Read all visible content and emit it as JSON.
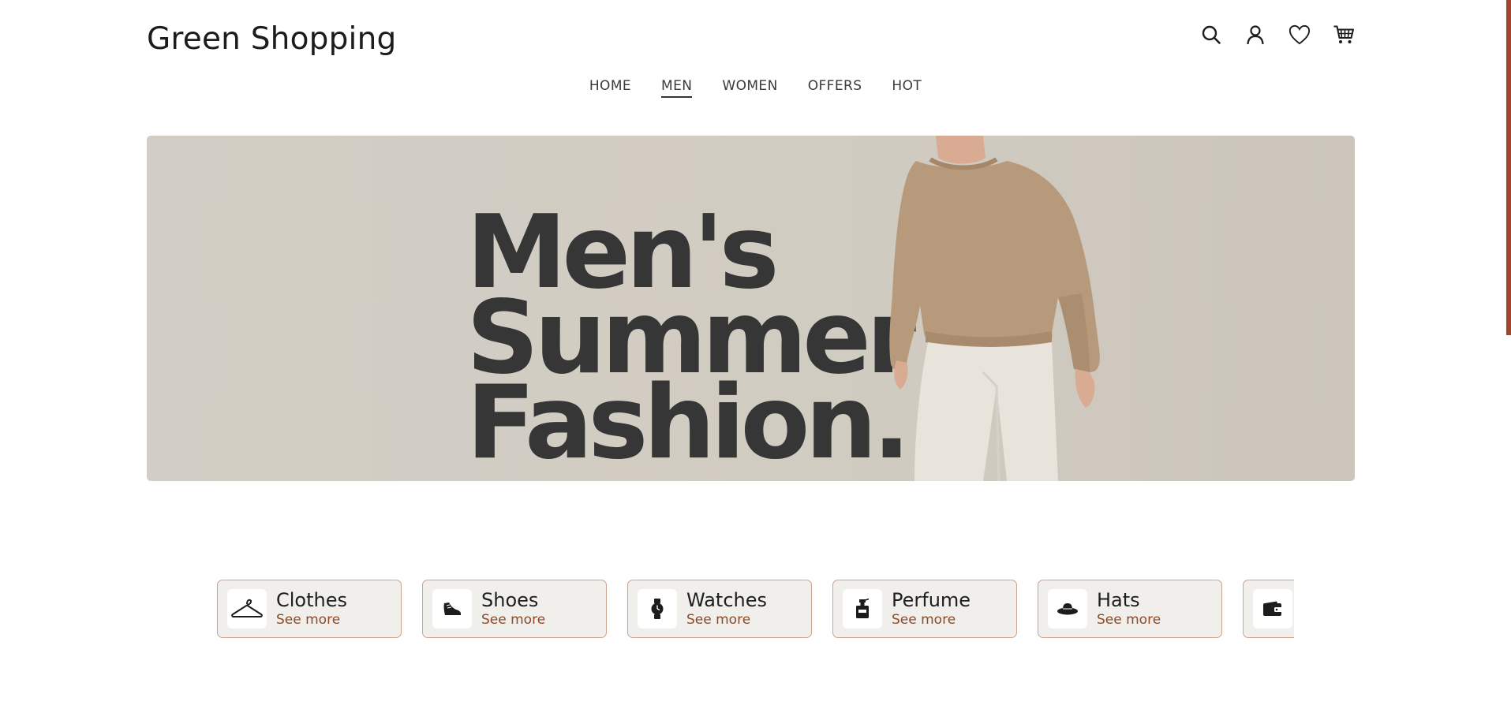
{
  "brand": {
    "name": "Green Shopping"
  },
  "header": {
    "icons": [
      "search-icon",
      "user-icon",
      "heart-icon",
      "cart-icon"
    ]
  },
  "nav": {
    "items": [
      {
        "label": "HOME",
        "active": false
      },
      {
        "label": "MEN",
        "active": true
      },
      {
        "label": "WOMEN",
        "active": false
      },
      {
        "label": "OFFERS",
        "active": false
      },
      {
        "label": "HOT",
        "active": false
      }
    ]
  },
  "hero": {
    "line1": "Men's",
    "line2": "Summer",
    "line3": "Fashion."
  },
  "categories": [
    {
      "name": "Clothes",
      "more": "See more",
      "icon": "hanger-icon"
    },
    {
      "name": "Shoes",
      "more": "See more",
      "icon": "shoe-icon"
    },
    {
      "name": "Watches",
      "more": "See more",
      "icon": "watch-icon"
    },
    {
      "name": "Perfume",
      "more": "See more",
      "icon": "perfume-icon"
    },
    {
      "name": "Hats",
      "more": "See more",
      "icon": "hat-icon"
    },
    {
      "name": "",
      "more": "",
      "icon": "wallet-icon"
    }
  ],
  "colors": {
    "accent": "#8a4b2b",
    "card_border": "#c9a58d",
    "card_bg": "#f0efeb",
    "hero_bg": "#d3cec5",
    "headline": "#363636",
    "scroll_accent": "#a0462a"
  }
}
